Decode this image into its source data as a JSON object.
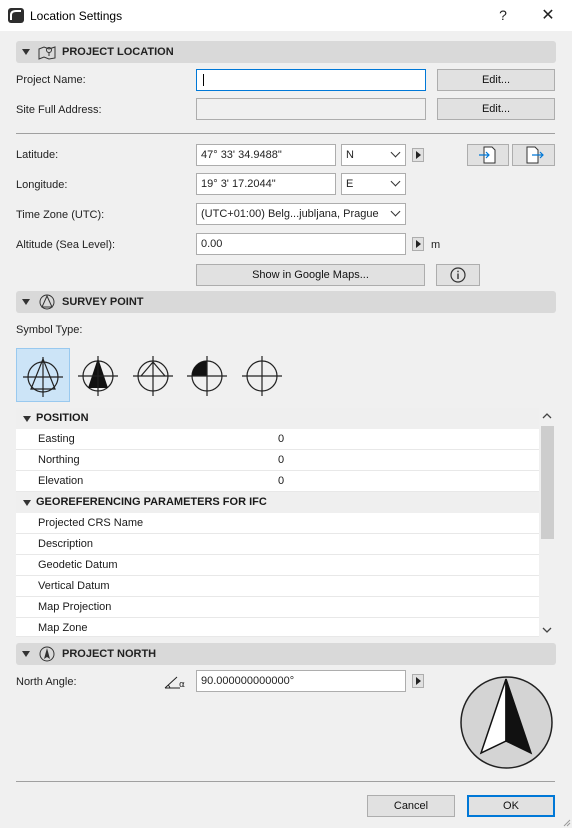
{
  "window": {
    "title": "Location Settings",
    "help": "?",
    "close": "✕"
  },
  "project_location": {
    "section_title": "PROJECT LOCATION",
    "project_name_label": "Project Name:",
    "project_name_value": "",
    "site_address_label": "Site Full Address:",
    "site_address_value": "",
    "edit_label": "Edit...",
    "latitude_label": "Latitude:",
    "latitude_value": "47° 33' 34.9488\"",
    "latitude_dir": "N",
    "longitude_label": "Longitude:",
    "longitude_value": "19° 3' 17.2044\"",
    "longitude_dir": "E",
    "timezone_label": "Time Zone (UTC):",
    "timezone_value": "(UTC+01:00) Belg...jubljana, Prague",
    "altitude_label": "Altitude (Sea Level):",
    "altitude_value": "0.00",
    "altitude_unit": "m",
    "maps_button": "Show in Google Maps...",
    "info_icon": "i"
  },
  "survey_point": {
    "section_title": "SURVEY POINT",
    "symbol_type_label": "Symbol Type:",
    "selected_symbol": 1
  },
  "position": {
    "title": "POSITION",
    "rows": [
      {
        "label": "Easting",
        "value": "0"
      },
      {
        "label": "Northing",
        "value": "0"
      },
      {
        "label": "Elevation",
        "value": "0"
      }
    ]
  },
  "georeferencing": {
    "title": "GEOREFERENCING PARAMETERS FOR IFC",
    "rows": [
      {
        "label": "Projected CRS Name",
        "value": ""
      },
      {
        "label": "Description",
        "value": ""
      },
      {
        "label": "Geodetic Datum",
        "value": ""
      },
      {
        "label": "Vertical Datum",
        "value": ""
      },
      {
        "label": "Map Projection",
        "value": ""
      },
      {
        "label": "Map Zone",
        "value": ""
      }
    ]
  },
  "project_north": {
    "section_title": "PROJECT NORTH",
    "north_angle_label": "North Angle:",
    "north_angle_value": "90.000000000000°"
  },
  "footer": {
    "cancel": "Cancel",
    "ok": "OK"
  },
  "colors": {
    "accent": "#0078d7",
    "selected_symbol_bg": "#cce4f7"
  }
}
